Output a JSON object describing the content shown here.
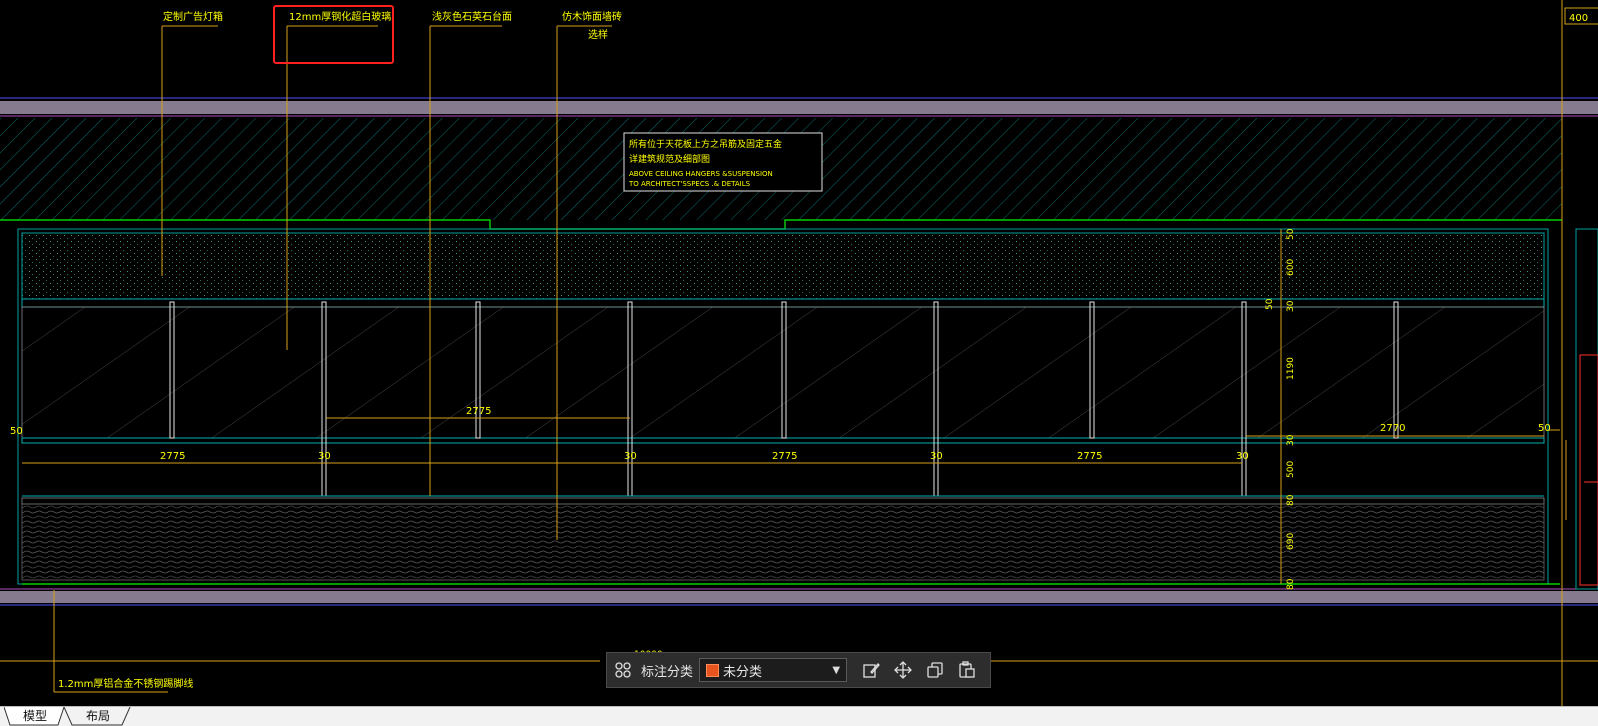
{
  "drawing": {
    "callouts": [
      {
        "text": "定制广告灯箱"
      },
      {
        "text": "12mm厚钢化超白玻璃"
      },
      {
        "text": "浅灰色石英石台面"
      },
      {
        "text": "仿木饰面墙砖"
      },
      {
        "text": "选样"
      },
      {
        "text": "1.2mm厚铝合金不锈钢踢脚线"
      },
      {
        "text": "400"
      }
    ],
    "note": {
      "line1": "所有位于天花板上方之吊筋及固定五金",
      "line2": "详建筑规范及细部图",
      "line3": "ABOVE CEILING HANGERS &SUSPENSION",
      "line4": "TO ARCHITECT'SSPECS .& DETAILS"
    },
    "dims_horizontal": [
      "2775",
      "30",
      "30",
      "2775",
      "30",
      "2775",
      "30",
      "2775",
      "2770",
      "50",
      "50",
      "10000"
    ],
    "dims_vertical": [
      "50",
      "600",
      "50",
      "30",
      "1190",
      "30",
      "500",
      "80",
      "690",
      "80"
    ]
  },
  "toolbar": {
    "label": "标注分类",
    "selected": "未分类",
    "icons": [
      "grid-icon",
      "edit-icon",
      "move-icon",
      "copy-icon",
      "paste-icon"
    ],
    "swatch_color": "#e8541e"
  },
  "tabs": [
    {
      "label": "模型",
      "active": true
    },
    {
      "label": "布局",
      "active": false
    }
  ],
  "colors": {
    "background": "#000000",
    "annotation": "#ffff00",
    "leader": "#d4a017",
    "structure": "#8a7a9a",
    "glass": "#00c0c0",
    "highlight_box": "#ff2020"
  }
}
